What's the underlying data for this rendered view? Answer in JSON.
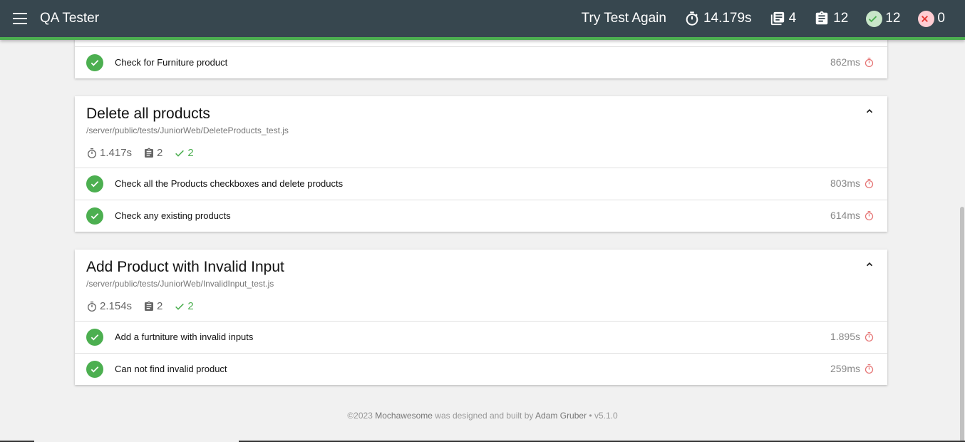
{
  "app": {
    "title": "QA Tester",
    "retry_label": "Try Test Again",
    "duration": "14.179s",
    "suites_count": "4",
    "tests_count": "12",
    "passed_count": "12",
    "failed_count": "0"
  },
  "colors": {
    "navbar": "#37474f",
    "pass": "#4caf50",
    "fail_badge": "#ffcdd2",
    "timer": "#e57373"
  },
  "top_partial": {
    "test_title": "Check for Furniture product",
    "duration": "862ms"
  },
  "suites": [
    {
      "title": "Delete all products",
      "file": "/server/public/tests/JuniorWeb/DeleteProducts_test.js",
      "duration": "1.417s",
      "tests": "2",
      "passes": "2",
      "items": [
        {
          "title": "Check all the Products checkboxes and delete products",
          "duration": "803ms"
        },
        {
          "title": "Check any existing products",
          "duration": "614ms"
        }
      ]
    },
    {
      "title": "Add Product with Invalid Input",
      "file": "/server/public/tests/JuniorWeb/InvalidInput_test.js",
      "duration": "2.154s",
      "tests": "2",
      "passes": "2",
      "items": [
        {
          "title": "Add a furtniture with invalid inputs",
          "duration": "1.895s"
        },
        {
          "title": "Can not find invalid product",
          "duration": "259ms"
        }
      ]
    }
  ],
  "footer": {
    "copyright": "©2023",
    "product": "Mochawesome",
    "middle": "was designed and built by",
    "author": "Adam Gruber",
    "version": "• v5.1.0"
  }
}
